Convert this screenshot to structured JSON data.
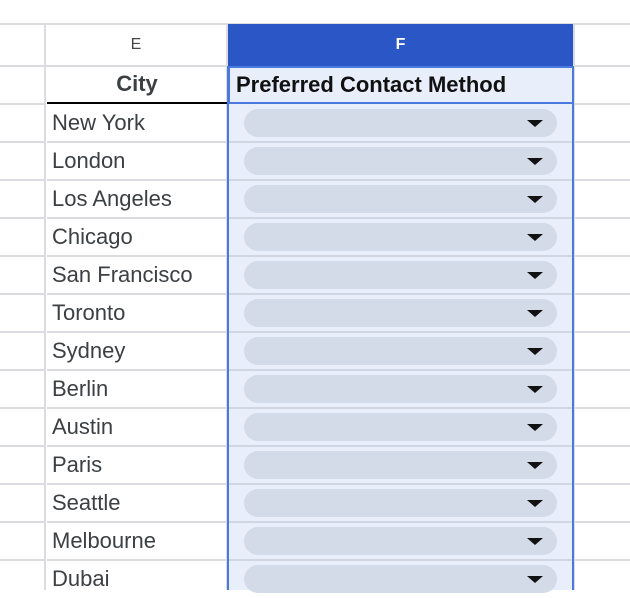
{
  "columns": [
    {
      "letter": "E",
      "selected": false
    },
    {
      "letter": "F",
      "selected": true
    }
  ],
  "header_row": {
    "E": "City",
    "F": "Preferred Contact Method"
  },
  "rows": [
    {
      "city": "New York",
      "contact_method": ""
    },
    {
      "city": "London",
      "contact_method": ""
    },
    {
      "city": "Los Angeles",
      "contact_method": ""
    },
    {
      "city": "Chicago",
      "contact_method": ""
    },
    {
      "city": "San Francisco",
      "contact_method": ""
    },
    {
      "city": "Toronto",
      "contact_method": ""
    },
    {
      "city": "Sydney",
      "contact_method": ""
    },
    {
      "city": "Berlin",
      "contact_method": ""
    },
    {
      "city": "Austin",
      "contact_method": ""
    },
    {
      "city": "Paris",
      "contact_method": ""
    },
    {
      "city": "Seattle",
      "contact_method": ""
    },
    {
      "city": "Melbourne",
      "contact_method": ""
    },
    {
      "city": "Dubai",
      "contact_method": ""
    }
  ],
  "colors": {
    "selected_column_header": "#2a56c6",
    "selection_border": "#4a7ae0",
    "selection_fill": "#e8effb",
    "dropdown_chip": "#d3dae8"
  },
  "icons": {
    "dropdown": "chevron-down-icon"
  }
}
